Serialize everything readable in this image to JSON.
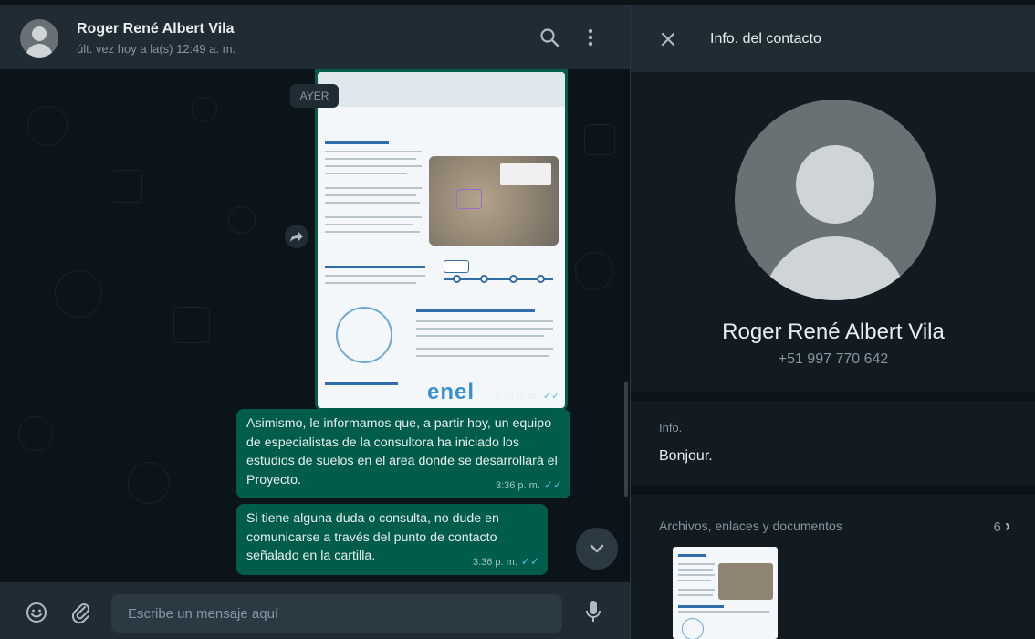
{
  "chat": {
    "contact_name": "Roger René Albert Vila",
    "last_seen": "últ. vez hoy a la(s) 12:49 a. m.",
    "date_chip": "AYER",
    "image_time": "3:36 p. m.",
    "image_logo": "enel",
    "messages": [
      {
        "text": "Asimismo, le informamos que, a partir hoy, un equipo de especialistas de la consultora ha iniciado los estudios de suelos en el área donde se desarrollará el Proyecto.",
        "time": "3:36 p. m.",
        "status": "read"
      },
      {
        "text": "Si tiene alguna duda o consulta, no dude en comunicarse a través del punto de contacto señalado en la cartilla.",
        "time": "3:36 p. m.",
        "status": "read"
      }
    ],
    "composer_placeholder": "Escribe un mensaje aquí"
  },
  "info": {
    "title": "Info. del contacto",
    "name": "Roger René Albert Vila",
    "phone": "+51 997 770 642",
    "about_label": "Info.",
    "about_text": "Bonjour.",
    "media_label": "Archivos, enlaces y documentos",
    "media_count": "6",
    "media_chevron": "›"
  },
  "ticks": "✓✓",
  "colors": {
    "header_bg": "#202c33",
    "chat_bg": "#0b141a",
    "outgoing_bubble": "#005c4b",
    "read_tick": "#53bdeb",
    "panel_bg": "#111b21",
    "text_primary": "#e9edef",
    "text_secondary": "#8696a0"
  },
  "icons": {
    "search": "search-icon",
    "menu": "more-vertical-icon",
    "close": "close-icon",
    "emoji": "emoji-icon",
    "attach": "paperclip-icon",
    "mic": "microphone-icon",
    "forward": "forward-icon",
    "scroll_down": "chevron-down-icon"
  }
}
